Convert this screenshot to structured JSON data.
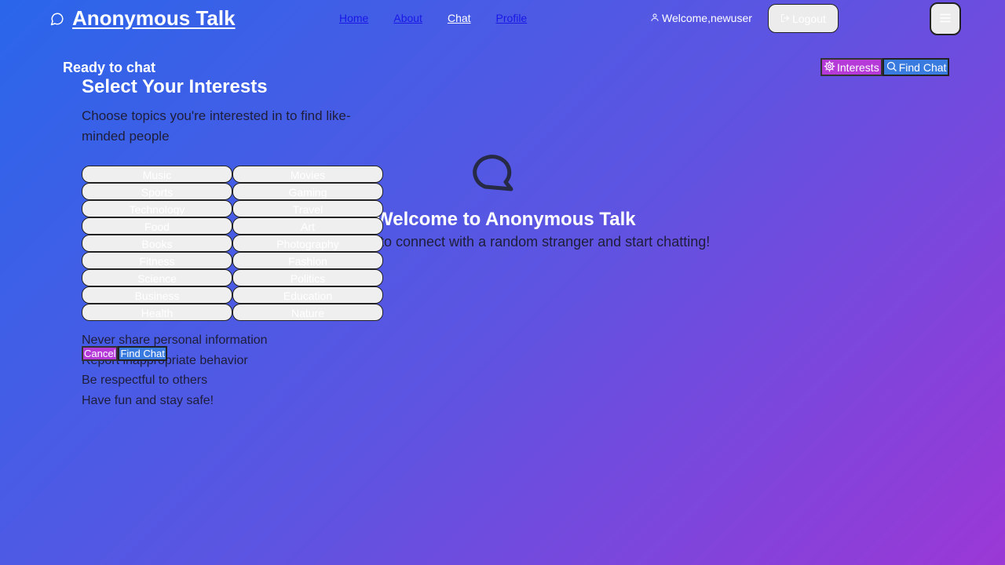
{
  "header": {
    "brand_title": "Anonymous Talk",
    "nav": [
      {
        "label": "Home",
        "active": false
      },
      {
        "label": "About",
        "active": false
      },
      {
        "label": "Chat",
        "active": true
      },
      {
        "label": "Profile",
        "active": false
      }
    ],
    "welcome_text": "Welcome,newuser",
    "logout_label": "Logout"
  },
  "status": {
    "text": "Ready to chat"
  },
  "top_actions": {
    "interests_label": "Interests",
    "find_chat_label": "Find Chat"
  },
  "center": {
    "title": "Welcome to Anonymous Talk",
    "subtitle": "to connect with a random stranger and start chatting!"
  },
  "interests_panel": {
    "title": "Select Your Interests",
    "description": "Choose topics you're interested in to find like-minded people",
    "interests": [
      "Music",
      "Movies",
      "Sports",
      "Gaming",
      "Technology",
      "Travel",
      "Food",
      "Art",
      "Books",
      "Photography",
      "Fitness",
      "Fashion",
      "Science",
      "Politics",
      "Business",
      "Education",
      "Health",
      "Nature"
    ],
    "tips": [
      "Never share personal information",
      "Report inappropriate behavior",
      "Be respectful to others",
      "Have fun and stay safe!"
    ],
    "cancel_label": "Cancel",
    "find_chat_label": "Find Chat"
  },
  "icons": {
    "brand": "chat-bubble-icon",
    "user": "user-icon",
    "logout": "logout-icon",
    "menu": "menu-icon",
    "settings": "gear-icon",
    "search": "search-icon",
    "center": "chat-bubble-icon"
  },
  "colors": {
    "bg_start": "#2a66ea",
    "bg_end": "#9b38d6",
    "accent_purple": "#b53ad8",
    "accent_blue": "#3a7be0"
  }
}
